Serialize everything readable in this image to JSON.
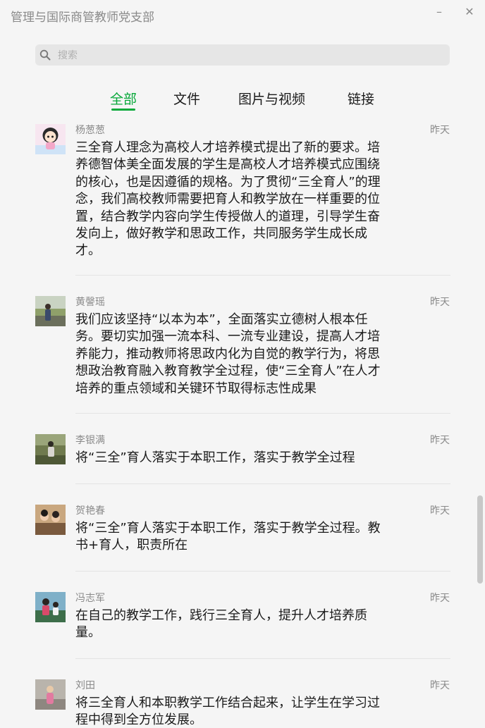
{
  "window": {
    "title": "管理与国际商管教师党支部",
    "minimize_glyph": "–",
    "close_glyph": "✕"
  },
  "search": {
    "placeholder": "搜索",
    "value": ""
  },
  "tabs": [
    {
      "label": "全部",
      "active": true
    },
    {
      "label": "文件",
      "active": false
    },
    {
      "label": "图片与视频",
      "active": false
    },
    {
      "label": "链接",
      "active": false
    }
  ],
  "colors": {
    "accent": "#07a839",
    "muted_text": "#8a8a8a",
    "background": "#f5f5f5"
  },
  "messages": [
    {
      "name": "杨葱葱",
      "time": "昨天",
      "avatar": "cartoon-girl-avatar",
      "content": "三全育人理念为高校人才培养模式提出了新的要求。培养德智体美全面发展的学生是高校人才培养模式应围绕的核心，也是因遵循的规格。为了贯彻“三全育人”的理念，我们高校教师需要把育人和教学放在一样重要的位置，结合教学内容向学生传授做人的道理，引导学生奋发向上，做好教学和思政工作，共同服务学生成长成才。"
    },
    {
      "name": "黄謦瑶",
      "time": "昨天",
      "avatar": "person-photo-avatar",
      "content": "我们应该坚持“以本为本”，全面落实立德树人根本任务。要切实加强一流本科、一流专业建设，提高人才培养能力，推动教师将思政内化为自觉的教学行为，将思想政治教育融入教育教学全过程，使“三全育人”在人才培养的重点领域和关键环节取得标志性成果"
    },
    {
      "name": "李银满",
      "time": "昨天",
      "avatar": "outdoor-photo-avatar",
      "content": "将“三全”育人落实于本职工作，落实于教学全过程"
    },
    {
      "name": "贺艳春",
      "time": "昨天",
      "avatar": "group-photo-avatar",
      "content": "将“三全”育人落实于本职工作，落实于教学全过程。教书+育人，职责所在"
    },
    {
      "name": "冯志军",
      "time": "昨天",
      "avatar": "family-photo-avatar",
      "content": "在自己的教学工作，践行三全育人，提升人才培养质量。"
    },
    {
      "name": "刘田",
      "time": "昨天",
      "avatar": "child-photo-avatar",
      "content": "将三全育人和本职教学工作结合起来，让学生在学习过程中得到全方位发展。"
    }
  ]
}
